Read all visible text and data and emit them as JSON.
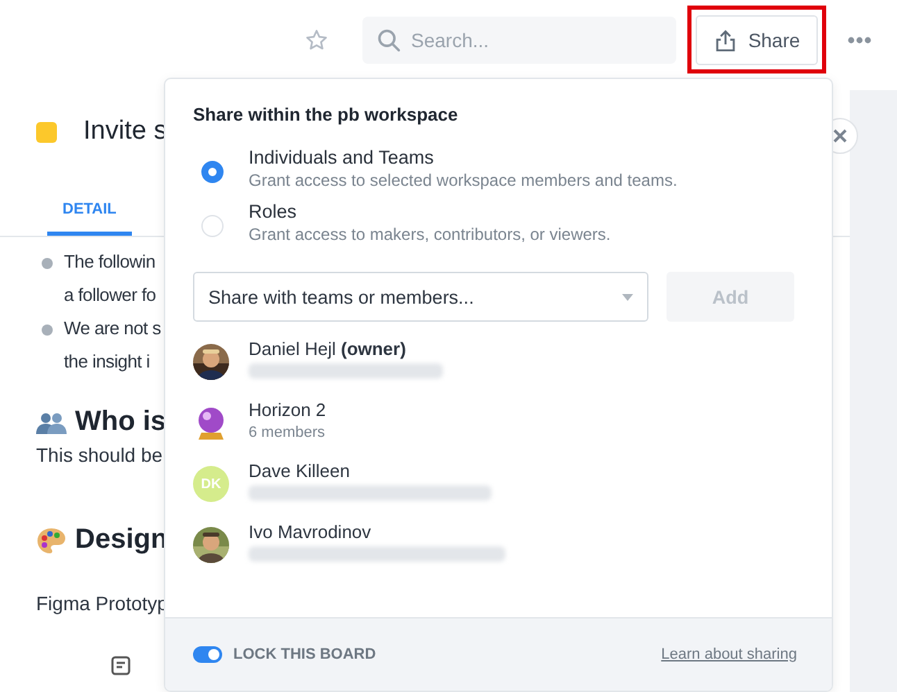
{
  "toolbar": {
    "search": {
      "placeholder": "Search..."
    },
    "share_button": {
      "label": "Share",
      "highlighted": true
    }
  },
  "page": {
    "title": "Invite s",
    "tabs": [
      {
        "label": "DETAIL",
        "selected": true
      }
    ],
    "bullets": [
      {
        "lines": [
          "The followin",
          "a follower fo"
        ]
      },
      {
        "lines": [
          "We are not s",
          "the insight i"
        ]
      }
    ],
    "sections": [
      {
        "kind": "people",
        "heading": "Who is",
        "text": "This should be"
      },
      {
        "kind": "palette",
        "heading": "Design",
        "text": "Figma Prototyp"
      }
    ]
  },
  "share_popup": {
    "title": "Share within the pb workspace",
    "options": [
      {
        "label": "Individuals and Teams",
        "description": "Grant access to selected workspace members and teams.",
        "selected": true
      },
      {
        "label": "Roles",
        "description": "Grant access to makers, contributors, or viewers.",
        "selected": false
      }
    ],
    "select": {
      "placeholder": "Share with teams or members..."
    },
    "add_button": {
      "label": "Add",
      "disabled": true
    },
    "members": [
      {
        "name": "Daniel Hejl **(owner)**"
      },
      {
        "name": "Horizon 2",
        "subtitle": "6 members",
        "avatar": {
          "kind": "crystal-ball"
        }
      },
      {
        "name": "Dave Killeen",
        "avatar": {
          "kind": "initials",
          "text": "DK",
          "color": "#d5ec8c"
        }
      },
      {
        "name": "Ivo Mavrodinov"
      }
    ],
    "lock_toggle": {
      "label": "LOCK THIS BOARD",
      "on": true
    },
    "link": "Learn about sharing"
  }
}
